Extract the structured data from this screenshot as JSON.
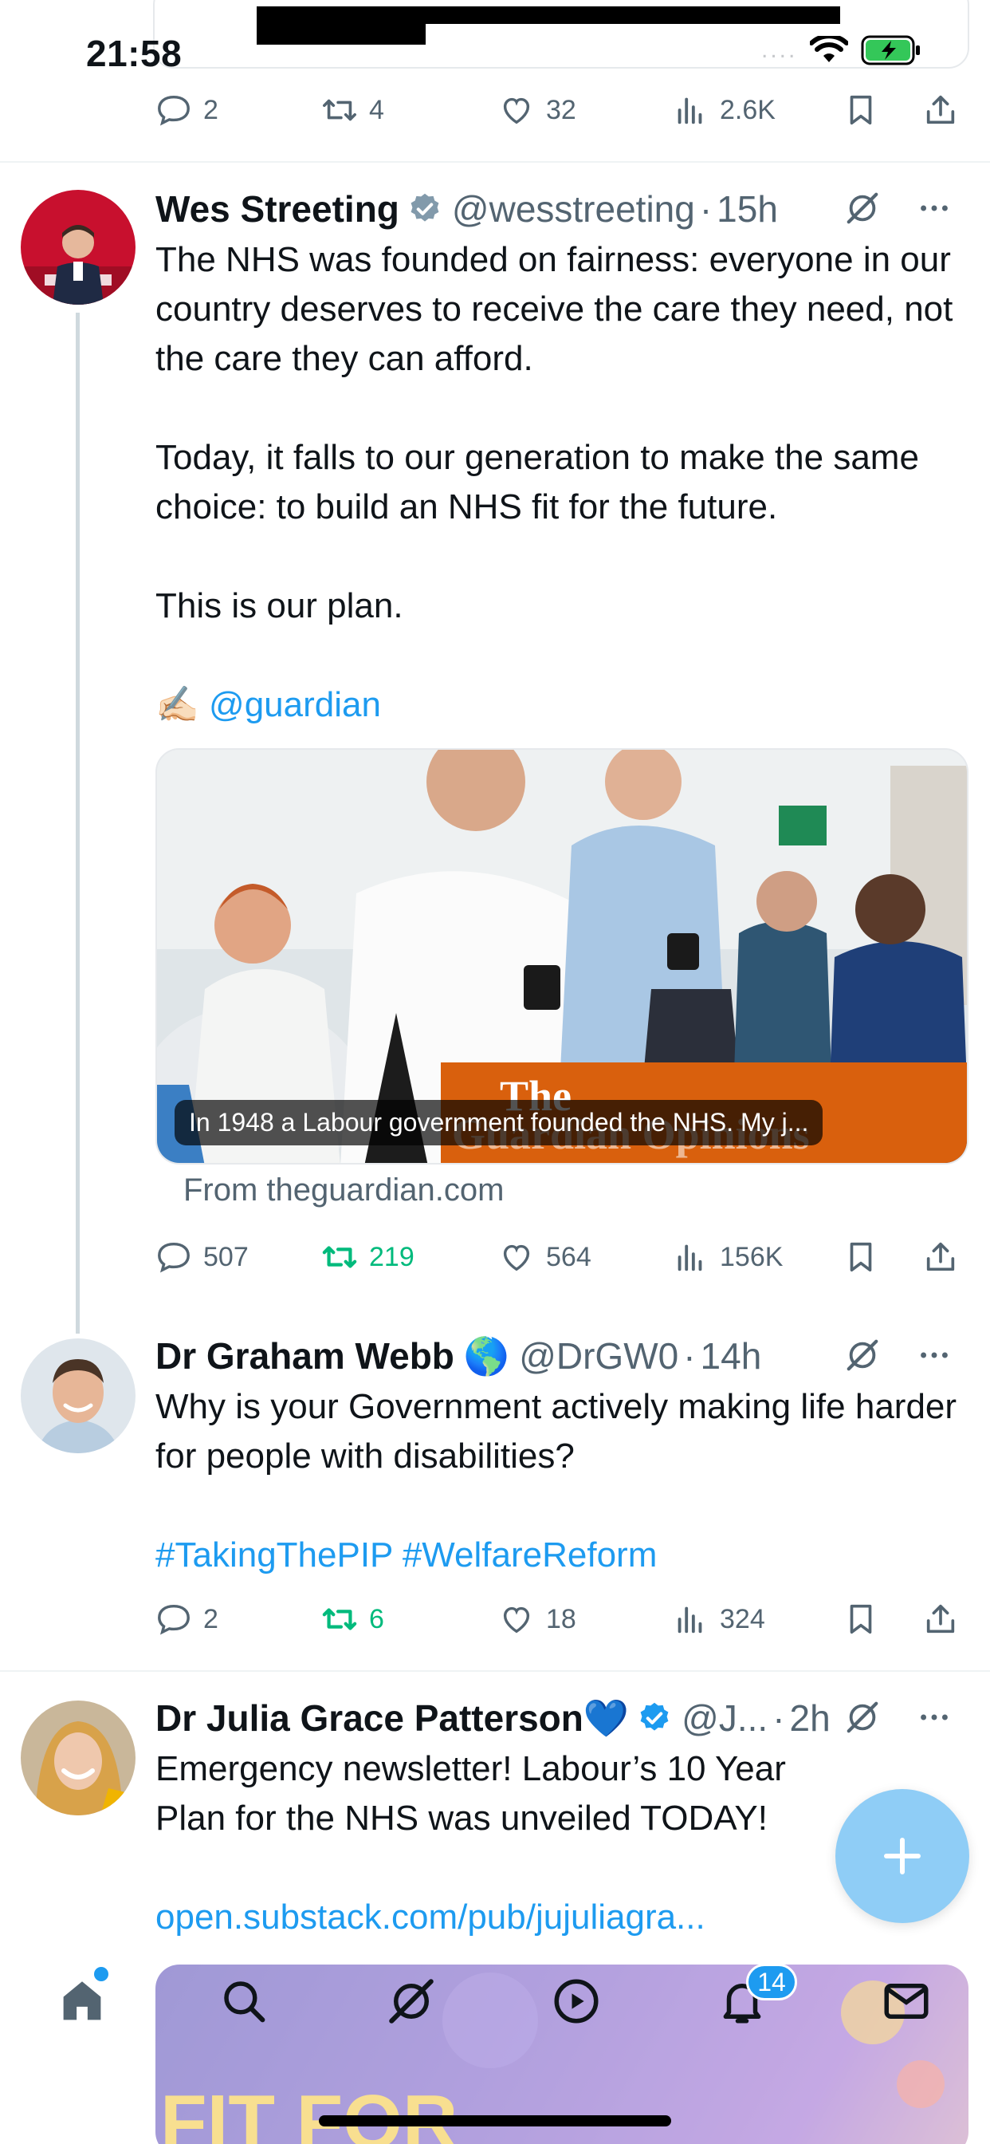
{
  "status_bar": {
    "time": "21:58",
    "signal_dots": "....",
    "battery_color": "#34c759"
  },
  "previous_tweet": {
    "actions": {
      "replies": "2",
      "retweets": "4",
      "likes": "32",
      "views": "2.6K"
    }
  },
  "tweets": [
    {
      "name": "Wes Streeting",
      "handle": "@wesstreeting",
      "sep": "·",
      "time": "15h",
      "paragraphs": [
        "The NHS was founded on fairness: everyone in our country deserves to receive the care they need, not the care they can afford.",
        "Today, it falls to our generation to make the same choice: to build an NHS fit for the future.",
        "This is our plan."
      ],
      "mention_emoji": "✍🏻",
      "mention": "@guardian",
      "card": {
        "caption": "In 1948 a Labour government founded the NHS. My j...",
        "brand_line1": "The",
        "brand_line2": "Guardian Opinions",
        "source": "From theguardian.com"
      },
      "actions": {
        "replies": "507",
        "retweets": "219",
        "likes": "564",
        "views": "156K"
      }
    },
    {
      "name": "Dr Graham Webb",
      "name_emoji": "🌎",
      "handle": "@DrGW0",
      "sep": "·",
      "time": "14h",
      "paragraphs": [
        "Why is your Government actively making life harder for people with disabilities?"
      ],
      "hashtags": "#TakingThePIP #WelfareReform",
      "actions": {
        "replies": "2",
        "retweets": "6",
        "likes": "18",
        "views": "324"
      }
    },
    {
      "name": "Dr Julia Grace Patterson",
      "name_emoji": "💙",
      "handle": "@J...",
      "sep": "·",
      "time": "2h",
      "paragraphs": [
        "Emergency newsletter! Labour’s 10 Year Plan for the NHS was unveiled TODAY!"
      ],
      "link": "open.substack.com/pub/jujuliagra...",
      "preview_text": "FIT FOR"
    }
  ],
  "bottom_nav": {
    "items": [
      "home",
      "search",
      "grok",
      "video",
      "notifications",
      "messages"
    ],
    "notifications_badge": "14"
  },
  "colors": {
    "accent": "#1d9bf0",
    "retweet_active": "#00ba7c",
    "muted": "#536471"
  }
}
